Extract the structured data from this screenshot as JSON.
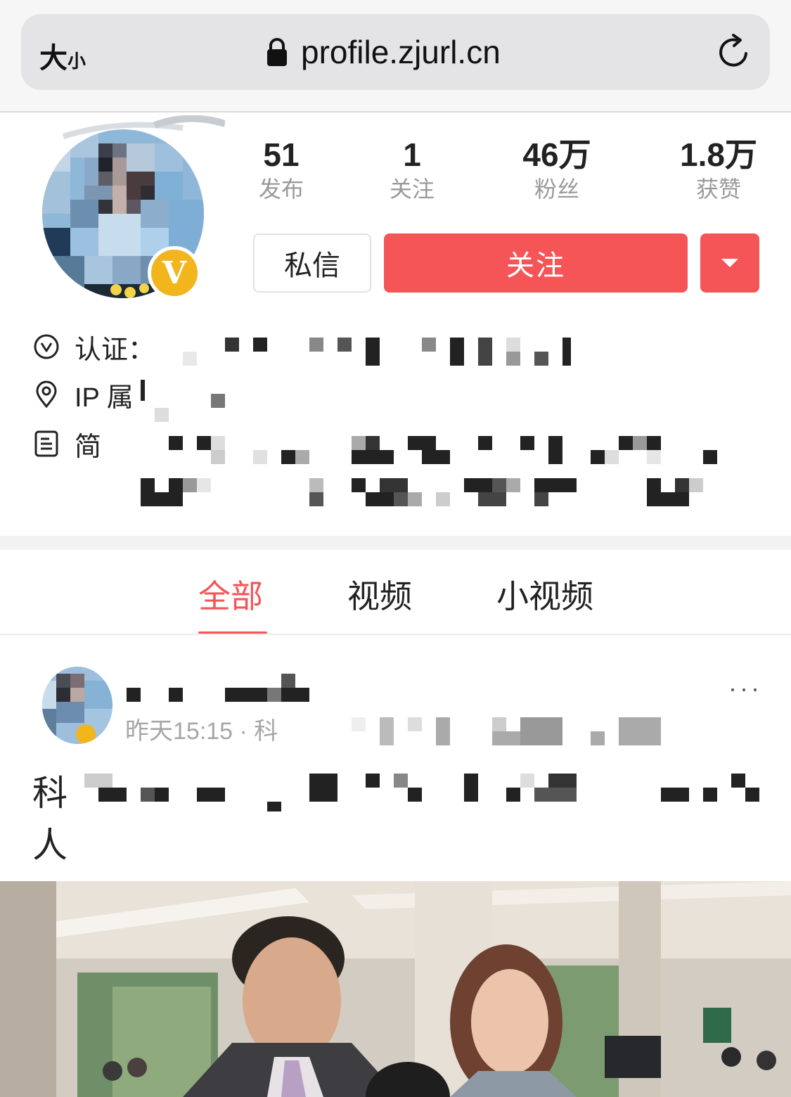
{
  "browser": {
    "text_size_big": "大",
    "text_size_small": "小",
    "url": "profile.zjurl.cn"
  },
  "profile": {
    "stats": [
      {
        "value": "51",
        "label": "发布"
      },
      {
        "value": "1",
        "label": "关注"
      },
      {
        "value": "46万",
        "label": "粉丝"
      },
      {
        "value": "1.8万",
        "label": "获赞"
      }
    ],
    "badge_letter": "V",
    "message_button": "私信",
    "follow_button": "关注",
    "info": {
      "verification_label": "认证：",
      "ip_label": "IP 属",
      "bio_label": "简"
    }
  },
  "tabs": [
    {
      "label": "全部",
      "active": true
    },
    {
      "label": "视频",
      "active": false
    },
    {
      "label": "小视频",
      "active": false
    }
  ],
  "post": {
    "more": "···",
    "meta": "昨天15:15 · 科",
    "text_line1_start": "科",
    "text_line2_start": "人"
  },
  "colors": {
    "accent": "#f55557",
    "badge": "#f2b51c",
    "muted_text": "#9a9a9a"
  }
}
